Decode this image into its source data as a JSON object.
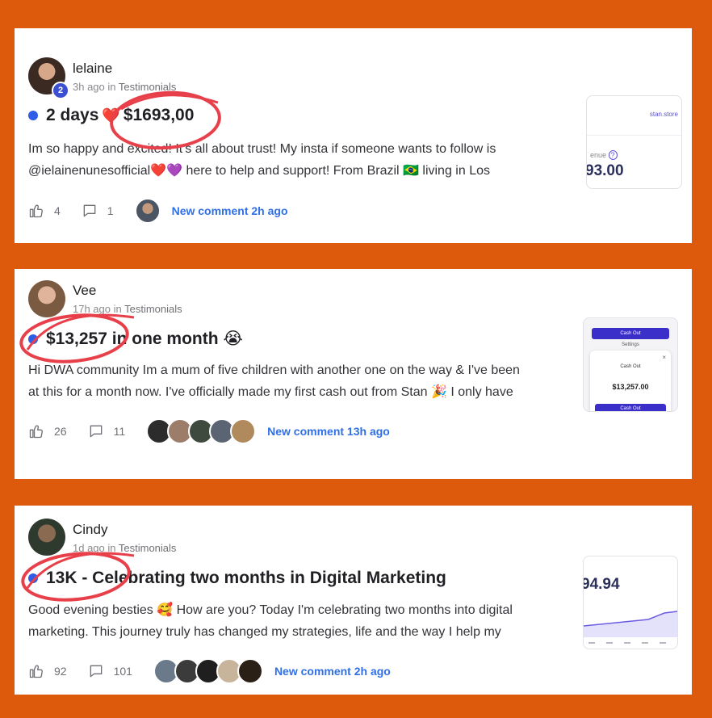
{
  "posts": [
    {
      "author": "lelaine",
      "badge": "2",
      "time": "3h ago in",
      "category": "Testimonials",
      "emoji": "❤️",
      "title_prefix": "2 days",
      "title_highlight": "$1693,00",
      "excerpt_line1": "Im so happy and excited! It's all about trust! My insta if someone wants to follow is",
      "excerpt_line2": "@ielainenunesofficial❤️💜 here to help and support! From Brazil 🇧🇷 living in Los",
      "likes": "4",
      "comments": "1",
      "new_comment": "New comment 2h ago",
      "thumb": {
        "site": "stan.store",
        "label": "enue",
        "value": "93.00"
      }
    },
    {
      "author": "Vee",
      "time": "17h ago in",
      "category": "Testimonials",
      "title": "$13,257 in one month 😭",
      "excerpt_line1": "Hi DWA community Im a mum of five children with another one on the way & I've been",
      "excerpt_line2": "at this for a month now. I've officially made my first cash out from Stan 🎉 I only have",
      "likes": "26",
      "comments": "11",
      "new_comment": "New comment 13h ago",
      "thumb": {
        "btn1": "Cash Out",
        "btn2": "Settings",
        "panel_label": "Cash Out",
        "value": "$13,257.00",
        "cta": "Cash Out"
      }
    },
    {
      "author": "Cindy",
      "time": "1d ago in",
      "category": "Testimonials",
      "title": "13K - Celebrating two months in Digital Marketing",
      "excerpt_line1": "Good evening besties 🥰 How are you? Today I'm celebrating two months into digital",
      "excerpt_line2": "marketing. This journey truly has changed my strategies, life and the way I help my",
      "likes": "92",
      "comments": "101",
      "new_comment": "New comment 2h ago",
      "thumb": {
        "value": "94.94"
      }
    }
  ],
  "colors": {
    "background": "#dd5a0c",
    "accent": "#2f5de8",
    "circle": "#e8404a"
  }
}
